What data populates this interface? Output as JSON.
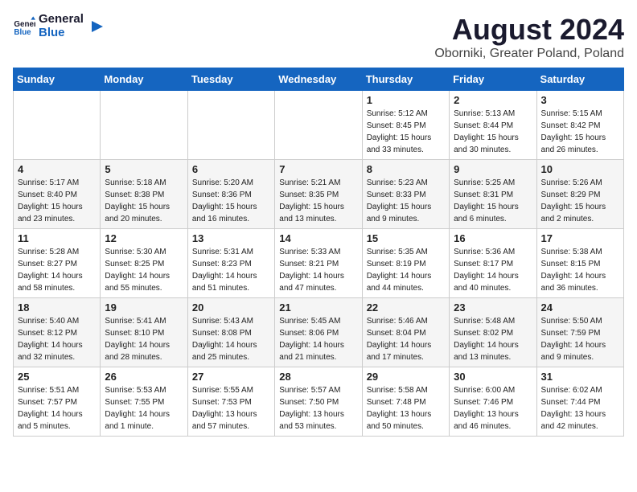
{
  "logo": {
    "text_general": "General",
    "text_blue": "Blue"
  },
  "title": "August 2024",
  "subtitle": "Oborniki, Greater Poland, Poland",
  "weekdays": [
    "Sunday",
    "Monday",
    "Tuesday",
    "Wednesday",
    "Thursday",
    "Friday",
    "Saturday"
  ],
  "weeks": [
    [
      {
        "day": "",
        "info": ""
      },
      {
        "day": "",
        "info": ""
      },
      {
        "day": "",
        "info": ""
      },
      {
        "day": "",
        "info": ""
      },
      {
        "day": "1",
        "info": "Sunrise: 5:12 AM\nSunset: 8:45 PM\nDaylight: 15 hours\nand 33 minutes."
      },
      {
        "day": "2",
        "info": "Sunrise: 5:13 AM\nSunset: 8:44 PM\nDaylight: 15 hours\nand 30 minutes."
      },
      {
        "day": "3",
        "info": "Sunrise: 5:15 AM\nSunset: 8:42 PM\nDaylight: 15 hours\nand 26 minutes."
      }
    ],
    [
      {
        "day": "4",
        "info": "Sunrise: 5:17 AM\nSunset: 8:40 PM\nDaylight: 15 hours\nand 23 minutes."
      },
      {
        "day": "5",
        "info": "Sunrise: 5:18 AM\nSunset: 8:38 PM\nDaylight: 15 hours\nand 20 minutes."
      },
      {
        "day": "6",
        "info": "Sunrise: 5:20 AM\nSunset: 8:36 PM\nDaylight: 15 hours\nand 16 minutes."
      },
      {
        "day": "7",
        "info": "Sunrise: 5:21 AM\nSunset: 8:35 PM\nDaylight: 15 hours\nand 13 minutes."
      },
      {
        "day": "8",
        "info": "Sunrise: 5:23 AM\nSunset: 8:33 PM\nDaylight: 15 hours\nand 9 minutes."
      },
      {
        "day": "9",
        "info": "Sunrise: 5:25 AM\nSunset: 8:31 PM\nDaylight: 15 hours\nand 6 minutes."
      },
      {
        "day": "10",
        "info": "Sunrise: 5:26 AM\nSunset: 8:29 PM\nDaylight: 15 hours\nand 2 minutes."
      }
    ],
    [
      {
        "day": "11",
        "info": "Sunrise: 5:28 AM\nSunset: 8:27 PM\nDaylight: 14 hours\nand 58 minutes."
      },
      {
        "day": "12",
        "info": "Sunrise: 5:30 AM\nSunset: 8:25 PM\nDaylight: 14 hours\nand 55 minutes."
      },
      {
        "day": "13",
        "info": "Sunrise: 5:31 AM\nSunset: 8:23 PM\nDaylight: 14 hours\nand 51 minutes."
      },
      {
        "day": "14",
        "info": "Sunrise: 5:33 AM\nSunset: 8:21 PM\nDaylight: 14 hours\nand 47 minutes."
      },
      {
        "day": "15",
        "info": "Sunrise: 5:35 AM\nSunset: 8:19 PM\nDaylight: 14 hours\nand 44 minutes."
      },
      {
        "day": "16",
        "info": "Sunrise: 5:36 AM\nSunset: 8:17 PM\nDaylight: 14 hours\nand 40 minutes."
      },
      {
        "day": "17",
        "info": "Sunrise: 5:38 AM\nSunset: 8:15 PM\nDaylight: 14 hours\nand 36 minutes."
      }
    ],
    [
      {
        "day": "18",
        "info": "Sunrise: 5:40 AM\nSunset: 8:12 PM\nDaylight: 14 hours\nand 32 minutes."
      },
      {
        "day": "19",
        "info": "Sunrise: 5:41 AM\nSunset: 8:10 PM\nDaylight: 14 hours\nand 28 minutes."
      },
      {
        "day": "20",
        "info": "Sunrise: 5:43 AM\nSunset: 8:08 PM\nDaylight: 14 hours\nand 25 minutes."
      },
      {
        "day": "21",
        "info": "Sunrise: 5:45 AM\nSunset: 8:06 PM\nDaylight: 14 hours\nand 21 minutes."
      },
      {
        "day": "22",
        "info": "Sunrise: 5:46 AM\nSunset: 8:04 PM\nDaylight: 14 hours\nand 17 minutes."
      },
      {
        "day": "23",
        "info": "Sunrise: 5:48 AM\nSunset: 8:02 PM\nDaylight: 14 hours\nand 13 minutes."
      },
      {
        "day": "24",
        "info": "Sunrise: 5:50 AM\nSunset: 7:59 PM\nDaylight: 14 hours\nand 9 minutes."
      }
    ],
    [
      {
        "day": "25",
        "info": "Sunrise: 5:51 AM\nSunset: 7:57 PM\nDaylight: 14 hours\nand 5 minutes."
      },
      {
        "day": "26",
        "info": "Sunrise: 5:53 AM\nSunset: 7:55 PM\nDaylight: 14 hours\nand 1 minute."
      },
      {
        "day": "27",
        "info": "Sunrise: 5:55 AM\nSunset: 7:53 PM\nDaylight: 13 hours\nand 57 minutes."
      },
      {
        "day": "28",
        "info": "Sunrise: 5:57 AM\nSunset: 7:50 PM\nDaylight: 13 hours\nand 53 minutes."
      },
      {
        "day": "29",
        "info": "Sunrise: 5:58 AM\nSunset: 7:48 PM\nDaylight: 13 hours\nand 50 minutes."
      },
      {
        "day": "30",
        "info": "Sunrise: 6:00 AM\nSunset: 7:46 PM\nDaylight: 13 hours\nand 46 minutes."
      },
      {
        "day": "31",
        "info": "Sunrise: 6:02 AM\nSunset: 7:44 PM\nDaylight: 13 hours\nand 42 minutes."
      }
    ]
  ]
}
